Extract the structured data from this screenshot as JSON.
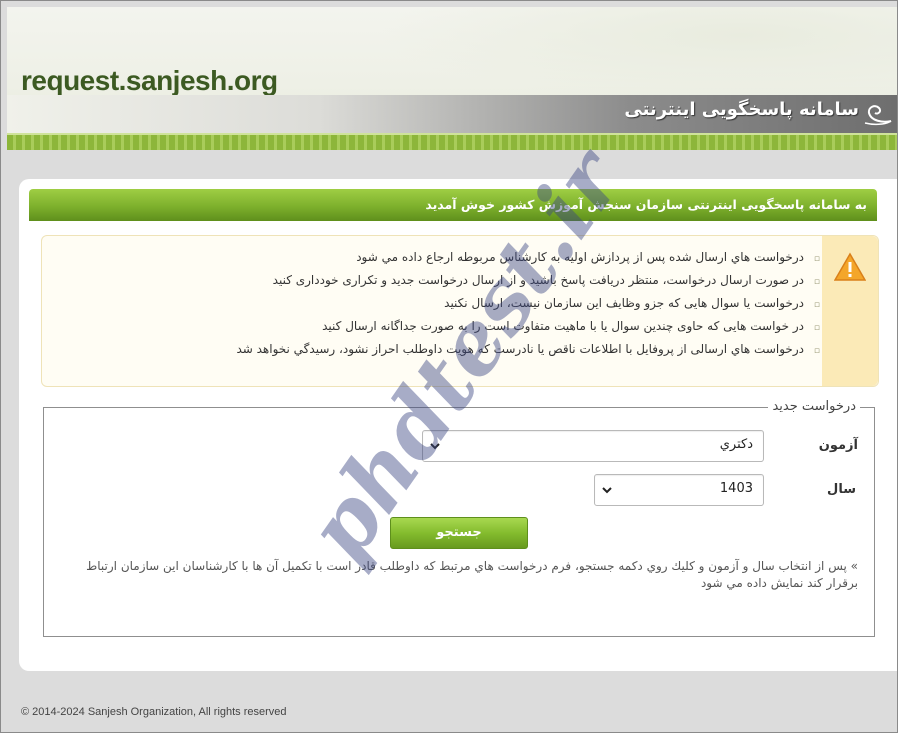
{
  "header": {
    "site_url": "request.sanjesh.org",
    "system_title": "سامانه پاسخگويی اينترنتی"
  },
  "welcome": {
    "text": "به سامانه پاسخگويی اينترنتی سازمان سنجش آموزش کشور خوش آمديد"
  },
  "notice": {
    "icon": "warning-icon",
    "items": [
      "درخواست هاي ارسال شده پس از پردازش اوليه به کارشناس مربوطه ارجاع داده مي شود",
      "در صورت ارسال درخواست، منتظر دريافت پاسخ باشيد و از ارسال درخواست جديد و تکراری خودداری کنيد",
      "درخواست يا سوال هايی که جزو وظايف اين سازمان نيست، ارسال نکنيد",
      "در خواست هايی که حاوی چندين سوال يا با ماهيت متفاوت است را به صورت جداگانه ارسال کنيد",
      "درخواست هاي ارسالی از پروفايل با اطلاعات ناقص يا نادرست که هويت داوطلب احراز نشود، رسيدگي نخواهد شد"
    ]
  },
  "form": {
    "legend": "درخواست جديد",
    "exam_label": "آزمون",
    "exam_value": "دکتري",
    "year_label": "سال",
    "year_value": "1403",
    "search_label": "جستجو",
    "help_text": "» پس از انتخاب سال و آزمون و کليك روي دکمه جستجو، فرم درخواست هاي مرتبط که داوطلب قادر است با تکميل آن ها با کارشناسان اين سازمان ارتباط برقرار کند نمايش داده مي شود"
  },
  "footer": {
    "copyright": "© 2014-2024 Sanjesh Organization, All rights reserved"
  },
  "watermark": {
    "text": "phdtest.ir"
  },
  "colors": {
    "accent_green": "#7db02c",
    "notice_bg": "#fbeab7",
    "warning_orange": "#f0a020"
  }
}
